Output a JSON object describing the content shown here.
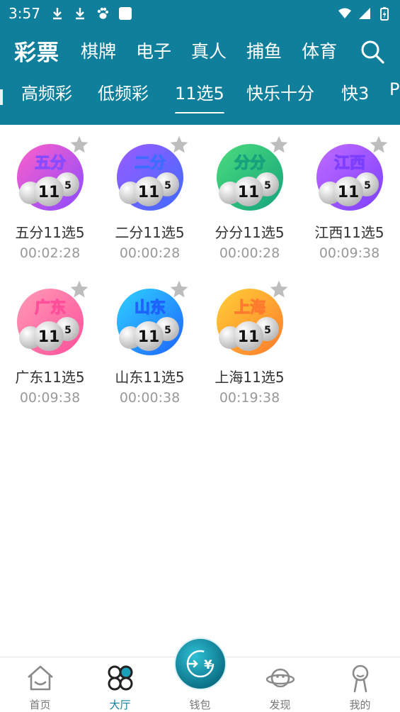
{
  "status_bar": {
    "time": "3:57"
  },
  "main_tabs": [
    {
      "label": "彩票",
      "active": true
    },
    {
      "label": "棋牌"
    },
    {
      "label": "电子"
    },
    {
      "label": "真人"
    },
    {
      "label": "捕鱼"
    },
    {
      "label": "体育"
    }
  ],
  "sub_tabs": [
    {
      "label": "高频彩"
    },
    {
      "label": "低频彩"
    },
    {
      "label": "11选5",
      "active": true
    },
    {
      "label": "快乐十分"
    },
    {
      "label": "快3"
    },
    {
      "label": "P"
    }
  ],
  "games": [
    {
      "badge": "五分",
      "name": "五分11选5",
      "time": "00:02:28",
      "colors": [
        "#ff5fc8",
        "#8a4bff"
      ]
    },
    {
      "badge": "二分",
      "name": "二分11选5",
      "time": "00:00:28",
      "colors": [
        "#9b5bff",
        "#3f6bff"
      ]
    },
    {
      "badge": "分分",
      "name": "分分11选5",
      "time": "00:00:28",
      "colors": [
        "#4bdc7d",
        "#16a37c"
      ]
    },
    {
      "badge": "江西",
      "name": "江西11选5",
      "time": "00:09:38",
      "colors": [
        "#c06bff",
        "#7d3fff"
      ]
    },
    {
      "badge": "广东",
      "name": "广东11选5",
      "time": "00:09:38",
      "colors": [
        "#ff9bb6",
        "#ff4f9a"
      ]
    },
    {
      "badge": "山东",
      "name": "山东11选5",
      "time": "00:00:38",
      "colors": [
        "#2ed2ff",
        "#1f63ff"
      ]
    },
    {
      "badge": "上海",
      "name": "上海11选5",
      "time": "00:19:38",
      "colors": [
        "#ffd035",
        "#ff7a2d"
      ]
    }
  ],
  "lottery_number": "11",
  "lottery_number_small": "5",
  "bottom_nav": [
    {
      "label": "首页",
      "icon": "home-icon"
    },
    {
      "label": "大厅",
      "icon": "hall-icon",
      "active": true
    },
    {
      "label": "钱包",
      "icon": "wallet-icon"
    },
    {
      "label": "发现",
      "icon": "discover-icon"
    },
    {
      "label": "我的",
      "icon": "profile-icon"
    }
  ],
  "colors": {
    "header_bg": "#0f7f9b",
    "star_inactive": "#bdbdbd",
    "wallet_accent": "#1aa0b8"
  }
}
